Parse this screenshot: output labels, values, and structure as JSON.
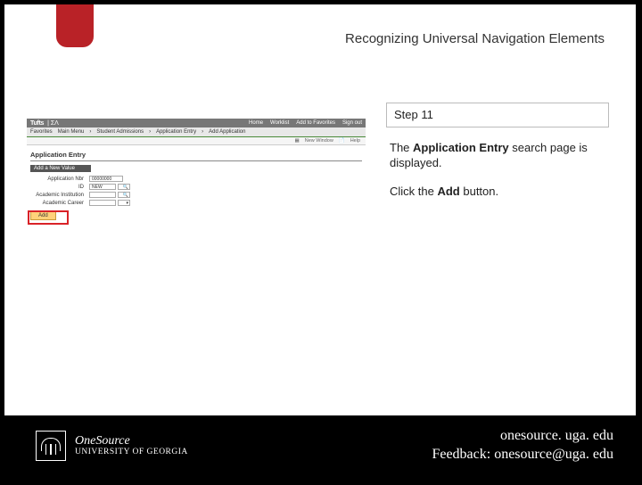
{
  "title": "Recognizing Universal Navigation Elements",
  "step": {
    "label": "Step 11",
    "para1_prefix": "The ",
    "para1_bold": "Application Entry",
    "para1_suffix": " search page is displayed.",
    "para2_prefix": "Click the ",
    "para2_bold": "Add",
    "para2_suffix": " button."
  },
  "screenshot": {
    "brand": "Tufts",
    "brand_sep": "| ΣΛ",
    "topnav": [
      "Home",
      "Worklist",
      "Add to Favorites",
      "Sign out"
    ],
    "breadcrumb": [
      "Favorites",
      "Main Menu",
      "Student Admissions",
      "Application Entry",
      "Add Application"
    ],
    "helpers": [
      "New Window",
      "Help"
    ],
    "page_title": "Application Entry",
    "section_label": "Add a New Value",
    "fields": [
      {
        "label": "Application Nbr",
        "value": "00000000"
      },
      {
        "label": "ID",
        "value": "NEW"
      },
      {
        "label": "Academic Institution",
        "value": ""
      },
      {
        "label": "Academic Career",
        "value": ""
      }
    ],
    "add_button": "Add"
  },
  "footer": {
    "logo_line1": "OneSource",
    "logo_line2": "UNIVERSITY OF GEORGIA",
    "url": "onesource. uga. edu",
    "feedback": "Feedback: onesource@uga. edu"
  }
}
